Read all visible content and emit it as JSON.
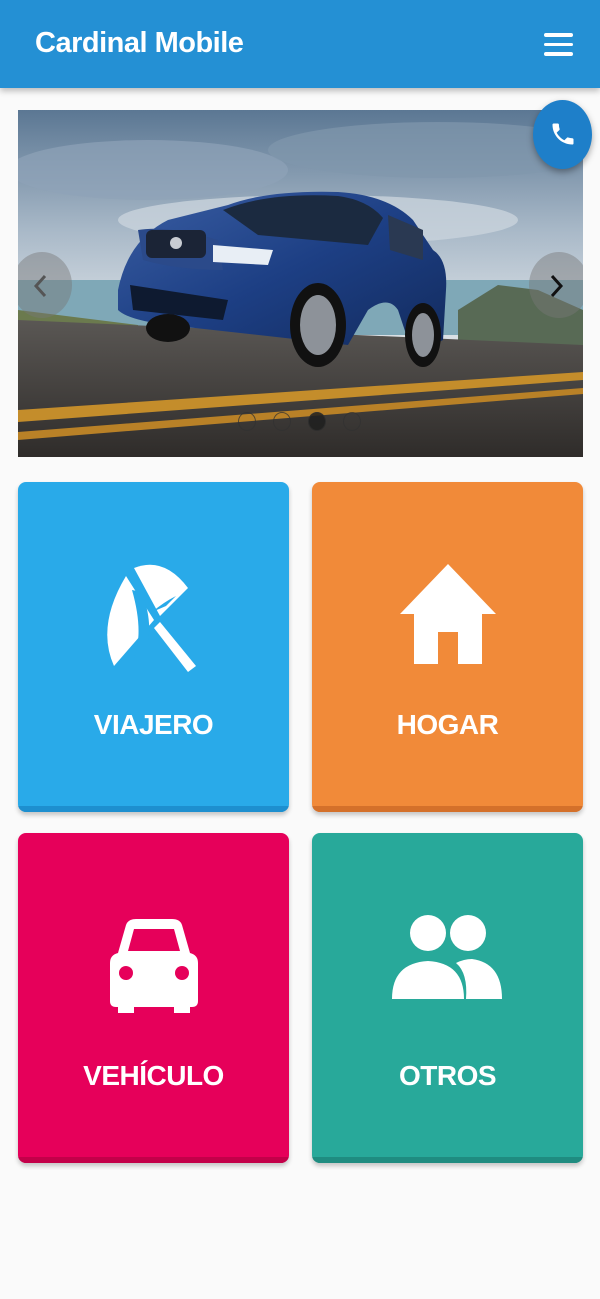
{
  "app": {
    "title": "Cardinal Mobile"
  },
  "header": {
    "menu_icon": "hamburger-menu-icon",
    "call_icon": "phone-icon"
  },
  "carousel": {
    "slide_count": 4,
    "active_index": 2,
    "prev_icon": "chevron-left-icon",
    "next_icon": "chevron-right-icon"
  },
  "tiles": [
    {
      "label": "VIAJERO",
      "icon": "beach-umbrella-icon",
      "color": "#29aae9"
    },
    {
      "label": "HOGAR",
      "icon": "home-icon",
      "color": "#f18a39"
    },
    {
      "label": "VEHÍCULO",
      "icon": "car-icon",
      "color": "#e6005a"
    },
    {
      "label": "OTROS",
      "icon": "people-icon",
      "color": "#28a99a"
    }
  ],
  "colors": {
    "appbar": "#2490d4",
    "accent": "#1e7fc9"
  }
}
